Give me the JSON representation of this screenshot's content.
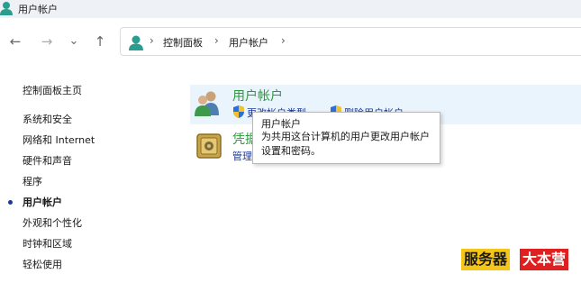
{
  "window": {
    "title": "用户帐户"
  },
  "nav": {
    "back": "←",
    "forward": "→",
    "recent": "⌄",
    "up": "↑"
  },
  "address": {
    "separator": "›",
    "crumbs": [
      "控制面板",
      "用户帐户"
    ]
  },
  "sidebar": {
    "home": "控制面板主页",
    "items": [
      {
        "label": "系统和安全"
      },
      {
        "label": "网络和 Internet"
      },
      {
        "label": "硬件和声音"
      },
      {
        "label": "程序"
      },
      {
        "label": "用户帐户",
        "active": true
      },
      {
        "label": "外观和个性化"
      },
      {
        "label": "时钟和区域"
      },
      {
        "label": "轻松使用"
      }
    ]
  },
  "main": {
    "categories": [
      {
        "title": "用户帐户",
        "icon": "users-icon",
        "links": [
          {
            "label": "更改帐户类型",
            "icon": "uac-shield-icon"
          },
          {
            "label": "删除用户帐户",
            "icon": "uac-shield-icon"
          }
        ]
      },
      {
        "title": "凭据管理器",
        "icon": "credential-vault-icon",
        "links": [
          {
            "label": "管理 Windows 凭据"
          }
        ]
      }
    ]
  },
  "tooltip": {
    "title": "用户帐户",
    "description": "为共用这台计算机的用户更改用户帐户设置和密码。"
  },
  "watermark": {
    "part1": "服务器",
    "part2": "大本营"
  },
  "colors": {
    "link": "#1a3a9a",
    "category_title": "#2a9a3a",
    "hover_bg": "#eaf4fd"
  }
}
